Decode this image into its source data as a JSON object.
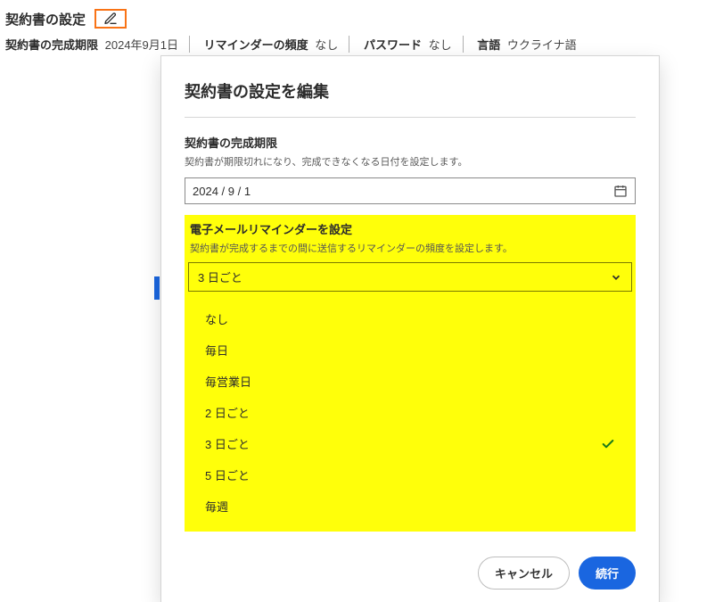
{
  "header": {
    "title": "契約書の設定"
  },
  "summary": {
    "deadline_label": "契約書の完成期限",
    "deadline_value": "2024年9月1日",
    "reminder_label": "リマインダーの頻度",
    "reminder_value": "なし",
    "password_label": "パスワード",
    "password_value": "なし",
    "language_label": "言語",
    "language_value": "ウクライナ語"
  },
  "modal": {
    "title": "契約書の設定を編集",
    "deadline": {
      "label": "契約書の完成期限",
      "help": "契約書が期限切れになり、完成できなくなる日付を設定します。",
      "date_display": "2024 /  9 /  1"
    },
    "reminder": {
      "label": "電子メールリマインダーを設定",
      "help": "契約書が完成するまでの間に送信するリマインダーの頻度を設定します。",
      "selected": "3 日ごと",
      "options": [
        "なし",
        "毎日",
        "毎営業日",
        "2 日ごと",
        "3 日ごと",
        "5 日ごと",
        "毎週"
      ]
    },
    "actions": {
      "cancel": "キャンセル",
      "continue": "続行"
    }
  }
}
